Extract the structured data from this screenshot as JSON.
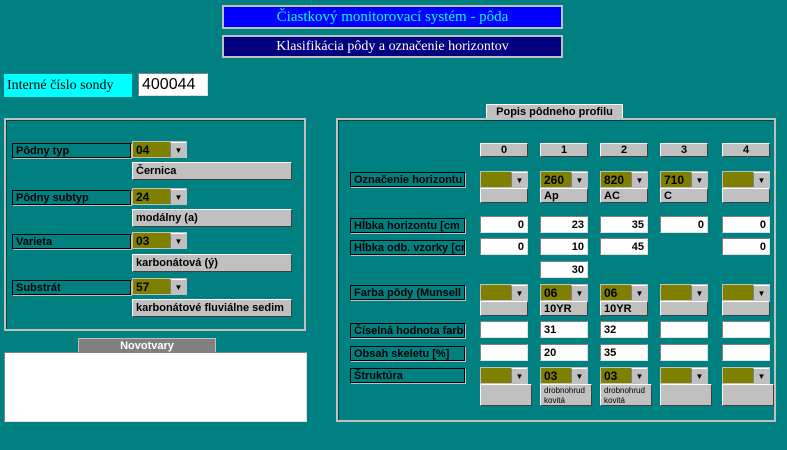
{
  "header": {
    "title": "Čiastkový monitorovací systém  - pôda",
    "subtitle": "Klasifikácia pôdy a označenie horizontov"
  },
  "probe": {
    "label": "Interné číslo sondy",
    "value": "400044"
  },
  "left_panel": {
    "fields": [
      {
        "label": "Pôdny typ",
        "code": "04",
        "description": "Černica"
      },
      {
        "label": "Pôdny subtyp",
        "code": "24",
        "description": "modálny (a)"
      },
      {
        "label": "Varieta",
        "code": "03",
        "description": "karbonátová (ý)"
      },
      {
        "label": "Substrát",
        "code": "57",
        "description": "karbonátové fluviálne sedim"
      }
    ]
  },
  "novotvary": {
    "title": "Novotvary",
    "value": ""
  },
  "profile": {
    "title": "Popis pôdneho profilu",
    "columns": [
      "0",
      "1",
      "2",
      "3",
      "4"
    ],
    "rows": {
      "oznacenie": {
        "label": "Označenie horizontu",
        "codes": [
          "",
          "260",
          "820",
          "710",
          ""
        ],
        "names": [
          "",
          "Ap",
          "AC",
          "C",
          ""
        ]
      },
      "hlbka_horizontu": {
        "label": "Hĺbka horizontu [cm",
        "values": [
          "0",
          "23",
          "35",
          "0",
          "0"
        ]
      },
      "hlbka_vzorky": {
        "label": "Hĺbka odb. vzorky [cn",
        "values": [
          "0",
          "10",
          "45",
          "",
          "0"
        ],
        "extra": "30"
      },
      "farba": {
        "label": "Farba pôdy (Munsell",
        "codes": [
          "",
          "06",
          "06",
          "",
          ""
        ],
        "names": [
          "",
          "10YR",
          "10YR",
          "",
          ""
        ]
      },
      "ciselna": {
        "label": "Číselná hodnota farb",
        "values": [
          "",
          "31",
          "32",
          "",
          ""
        ]
      },
      "skelet": {
        "label": "Obsah skeletu [%]",
        "values": [
          "",
          "20",
          "35",
          "",
          ""
        ]
      },
      "struktura": {
        "label": "Štruktúra",
        "codes": [
          "",
          "03",
          "03",
          "",
          ""
        ],
        "names": [
          "",
          "drobnohrud kovitá",
          "drobnohrud kovitá",
          "",
          ""
        ]
      }
    }
  },
  "icons": {
    "dropdown": "triangle-down-icon"
  },
  "colors": {
    "background": "#008080",
    "combo": "#808000",
    "title_bg": "#0000ff",
    "title_text": "#00ffff",
    "subtitle_bg": "#000080"
  }
}
